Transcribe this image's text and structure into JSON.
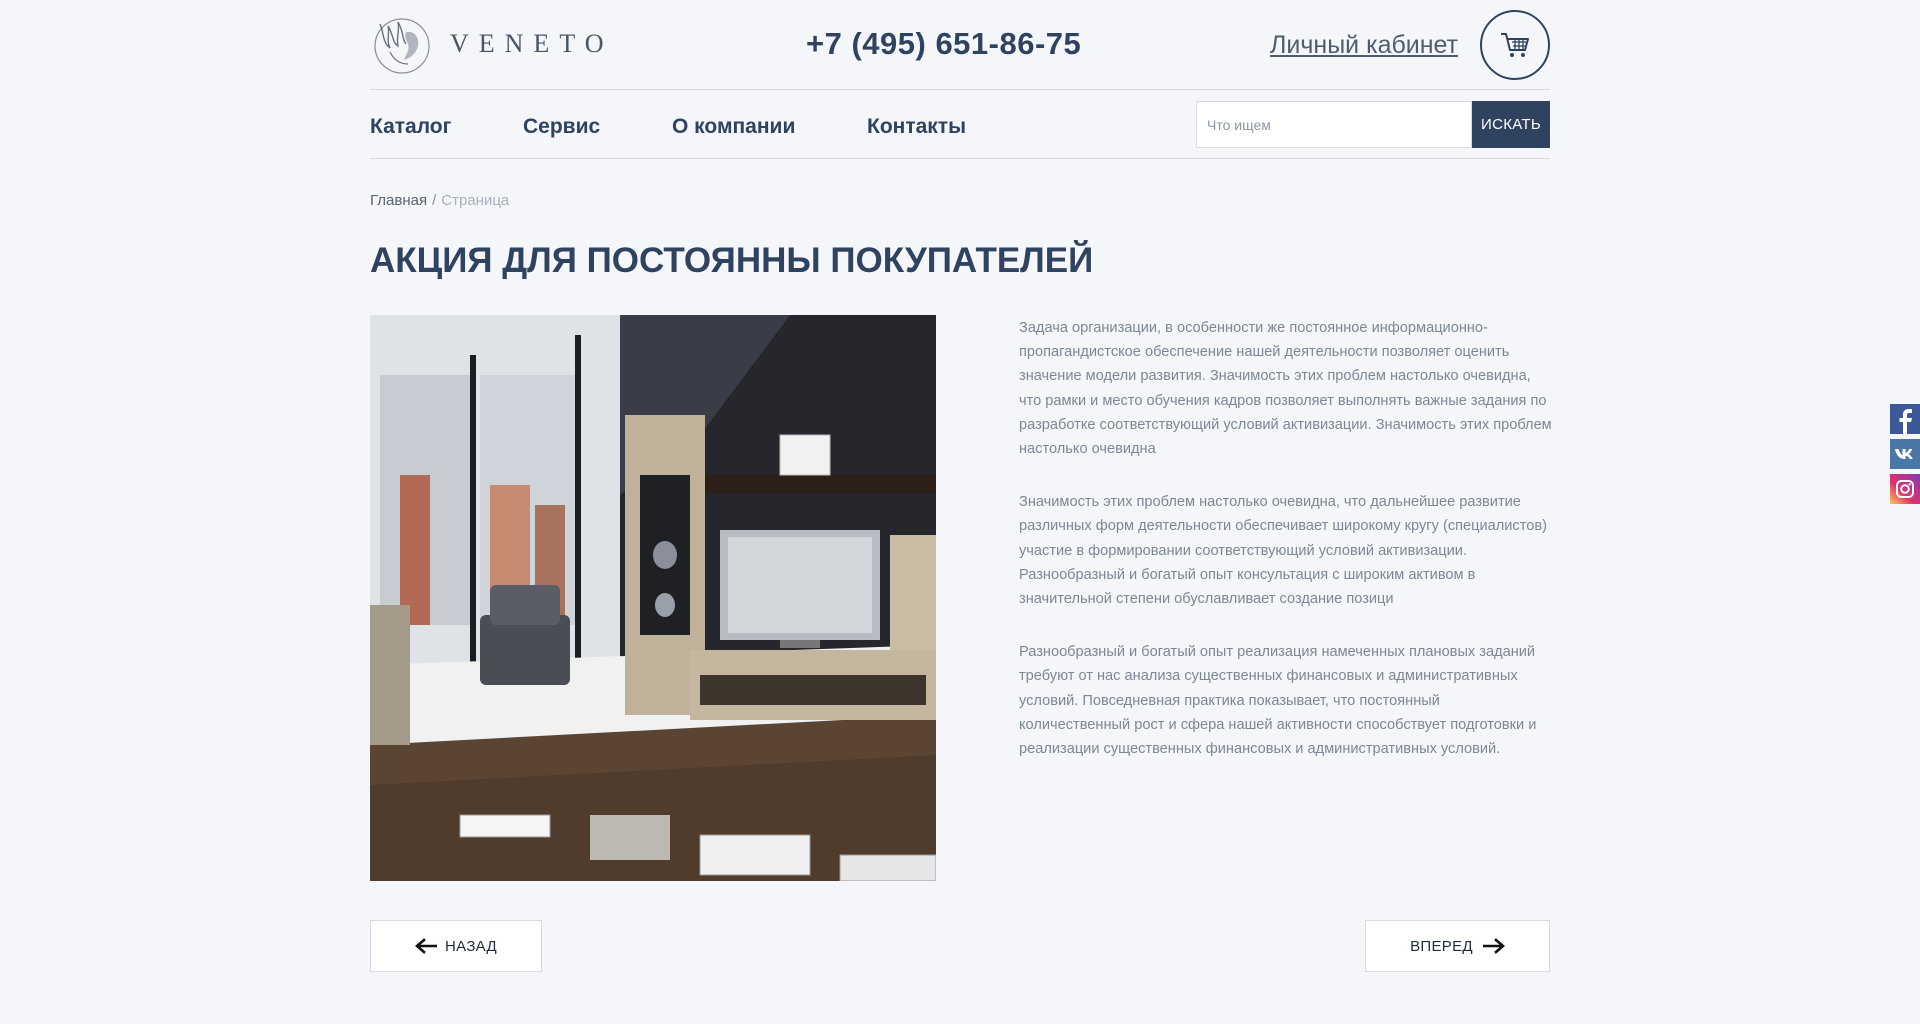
{
  "header": {
    "logo_text": "VENETO",
    "phone": "+7 (495) 651-86-75",
    "account_label": "Личный кабинет",
    "cart_icon": "cart-icon"
  },
  "nav": {
    "items": [
      {
        "label": "Каталог"
      },
      {
        "label": "Сервис"
      },
      {
        "label": "О компании"
      },
      {
        "label": "Контакты"
      }
    ],
    "search": {
      "placeholder": "Что ищем",
      "value": "",
      "button_label": "ИСКАТЬ"
    }
  },
  "breadcrumb": {
    "home": "Главная",
    "separator": "/",
    "current": "Страница"
  },
  "page_title": "АКЦИЯ ДЛЯ ПОСТОЯННЫ ПОКУПАТЕЛЕЙ",
  "article": {
    "paragraphs": [
      "Задача организации, в особенности же постоянное информационно-пропагандистское обеспечение нашей деятельности позволяет оценить значение модели развития. Значимость этих проблем настолько очевидна, что рамки и место обучения кадров позволяет выполнять важные задания по разработке соответствующий условий активизации. Значимость этих проблем настолько очевидна",
      "Значимость этих проблем настолько очевидна, что дальнейшее развитие различных форм деятельности обеспечивает широкому кругу (специалистов) участие в формировании соответствующий условий активизации. Разнообразный и богатый опыт консультация с широким активом в значительной степени обуславливает создание позици",
      "Разнообразный и богатый опыт реализация намеченных плановых заданий требуют от нас анализа существенных финансовых и административных условий. Повседневная практика показывает, что постоянный количественный рост и сфера нашей активности способствует подготовки и реализации существенных финансовых и административных условий."
    ]
  },
  "pager": {
    "back_label": "НАЗАД",
    "forward_label": "ВПЕРЕД"
  },
  "social": [
    {
      "icon": "facebook-icon",
      "color": "#3b5998"
    },
    {
      "icon": "vk-icon",
      "color": "#4a76a8"
    },
    {
      "icon": "instagram-icon",
      "color": "#c13584"
    }
  ],
  "colors": {
    "accent": "#2f4360",
    "background": "#f4f6f9"
  }
}
